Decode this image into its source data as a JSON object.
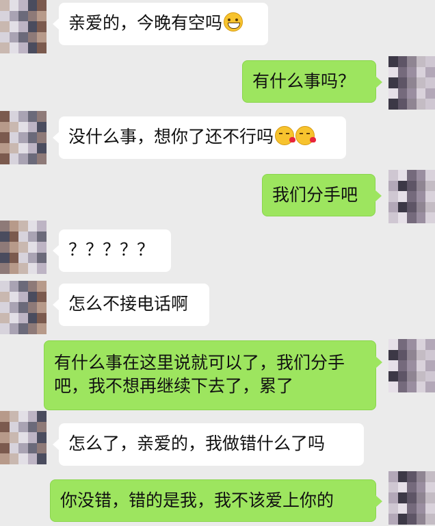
{
  "messages": [
    {
      "side": "left",
      "text": "亲爱的，今晚有空吗",
      "emoji": [
        "grin-emoji"
      ]
    },
    {
      "side": "right",
      "text": "有什么事吗？"
    },
    {
      "side": "left",
      "text": "没什么事，想你了还不行吗",
      "emoji": [
        "kiss-emoji",
        "kiss-emoji"
      ]
    },
    {
      "side": "right",
      "text": "我们分手吧"
    },
    {
      "side": "left",
      "text": "？？？？？"
    },
    {
      "side": "left",
      "text": "怎么不接电话啊"
    },
    {
      "side": "right",
      "text": "有什么事在这里说就可以了，我们分手吧，我不想再继续下去了，累了"
    },
    {
      "side": "left",
      "text": "怎么了，亲爱的，我做错什么了吗"
    },
    {
      "side": "right",
      "text": "你没错，错的是我，我不该爱上你的"
    }
  ],
  "colors": {
    "background": "#ebebeb",
    "incoming_bubble": "#ffffff",
    "outgoing_bubble": "#9de55f"
  },
  "avatars": {
    "contact": "pixelated-avatar",
    "self": "pixelated-avatar"
  }
}
